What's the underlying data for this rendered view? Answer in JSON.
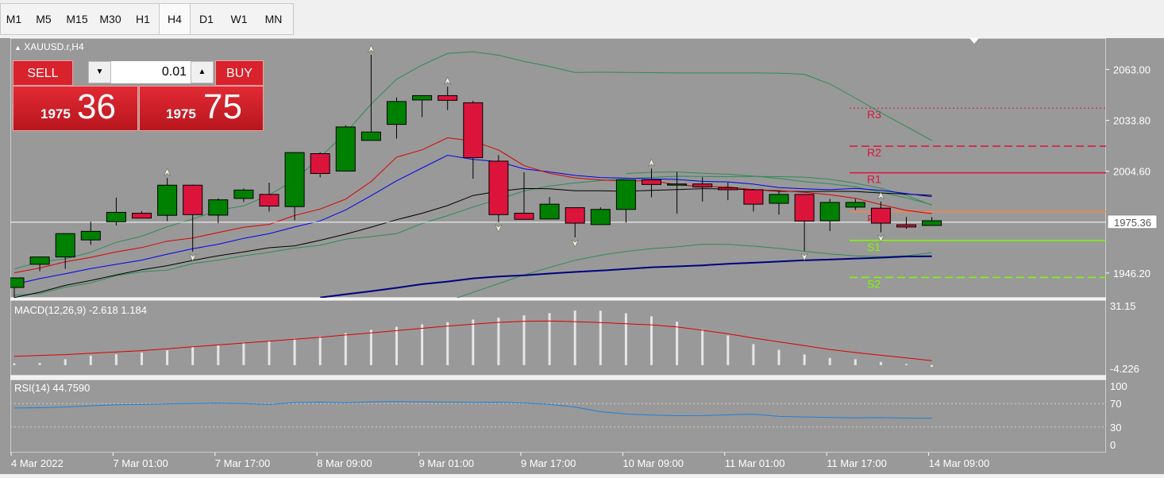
{
  "timeframes": [
    "M1",
    "M5",
    "M15",
    "M30",
    "H1",
    "H4",
    "D1",
    "W1",
    "MN"
  ],
  "active_timeframe": "H4",
  "symbol_label": "XAUUSD.r,H4",
  "trade": {
    "sell_label": "SELL",
    "buy_label": "BUY",
    "lot": "0.01",
    "sell_small": "1975",
    "sell_big": "36",
    "buy_small": "1975",
    "buy_big": "75"
  },
  "price_axis": [
    "2063.00",
    "2033.80",
    "2004.60",
    "1975.36",
    "1946.20"
  ],
  "current_price": "1975.36",
  "pivots": [
    "R3",
    "R2",
    "R1",
    "PP",
    "S1",
    "S2"
  ],
  "macd": {
    "label": "MACD(12,26,9) -2.618 1.184",
    "axis_top": "31.15",
    "axis_bottom": "-4.226"
  },
  "rsi": {
    "label": "RSI(14) 44.7590",
    "axis": [
      "100",
      "70",
      "30",
      "0"
    ]
  },
  "time_axis": [
    "4 Mar 2022",
    "7 Mar 01:00",
    "7 Mar 17:00",
    "8 Mar 09:00",
    "9 Mar 01:00",
    "9 Mar 17:00",
    "10 Mar 09:00",
    "11 Mar 01:00",
    "11 Mar 17:00",
    "14 Mar 09:00"
  ],
  "colors": {
    "background": "#999999",
    "bull": "#008000",
    "bear": "#dc143c",
    "macd_signal": "#dc0000",
    "rsi": "#1e7fd8",
    "ma_blue": "#0000ee",
    "ma_red": "#dc0000",
    "ma_black": "#000000",
    "ma_navy": "#000080",
    "bands": "#2e8b57"
  },
  "chart_data": {
    "type": "candlestick",
    "symbol": "XAUUSD.r",
    "timeframe": "H4",
    "ylim": [
      1932,
      2081
    ],
    "candles": [
      {
        "o": 1937.9,
        "h": 1943.4,
        "l": 1929.6,
        "c": 1943.4
      },
      {
        "o": 1951.2,
        "h": 1955.6,
        "l": 1947.2,
        "c": 1955.4
      },
      {
        "o": 1955.4,
        "h": 1969.0,
        "l": 1948.6,
        "c": 1968.8
      },
      {
        "o": 1965.2,
        "h": 1975.6,
        "l": 1962.4,
        "c": 1970.1
      },
      {
        "o": 1975.6,
        "h": 1989.5,
        "l": 1973.5,
        "c": 1981.0
      },
      {
        "o": 1980.5,
        "h": 1981.7,
        "l": 1977.7,
        "c": 1977.7
      },
      {
        "o": 1979.3,
        "h": 2000.7,
        "l": 1976.0,
        "c": 1996.6
      },
      {
        "o": 1996.6,
        "h": 1996.9,
        "l": 1958.5,
        "c": 1979.7
      },
      {
        "o": 1979.4,
        "h": 1989.0,
        "l": 1974.7,
        "c": 1988.2
      },
      {
        "o": 1989.0,
        "h": 1994.7,
        "l": 1986.9,
        "c": 1993.8
      },
      {
        "o": 1991.3,
        "h": 1998.0,
        "l": 1981.5,
        "c": 1984.6
      },
      {
        "o": 1984.3,
        "h": 2014.7,
        "l": 1976.4,
        "c": 2015.3
      },
      {
        "o": 2014.7,
        "h": 2015.5,
        "l": 2001.1,
        "c": 2003.3
      },
      {
        "o": 2004.7,
        "h": 2031.0,
        "l": 2004.7,
        "c": 2030.0
      },
      {
        "o": 2022.3,
        "h": 2071.4,
        "l": 2022.3,
        "c": 2027.1
      },
      {
        "o": 2031.5,
        "h": 2047.0,
        "l": 2023.3,
        "c": 2044.6
      },
      {
        "o": 2045.5,
        "h": 2046.4,
        "l": 2035.7,
        "c": 2048.0
      },
      {
        "o": 2048.0,
        "h": 2053.1,
        "l": 2039.7,
        "c": 2045.3
      },
      {
        "o": 2043.9,
        "h": 2045.0,
        "l": 2000.3,
        "c": 2012.4
      },
      {
        "o": 2010.4,
        "h": 2013.8,
        "l": 1975.3,
        "c": 1979.7
      },
      {
        "o": 1980.5,
        "h": 2004.1,
        "l": 1977.0,
        "c": 1977.0
      },
      {
        "o": 1977.2,
        "h": 1989.8,
        "l": 1977.2,
        "c": 1985.7
      },
      {
        "o": 1983.7,
        "h": 1983.7,
        "l": 1966.6,
        "c": 1974.8
      },
      {
        "o": 1974.0,
        "h": 1983.9,
        "l": 1974.0,
        "c": 1982.7
      },
      {
        "o": 1982.7,
        "h": 1999.6,
        "l": 1975.1,
        "c": 1999.6
      },
      {
        "o": 1999.6,
        "h": 2006.1,
        "l": 1989.7,
        "c": 1997.0
      },
      {
        "o": 1997.3,
        "h": 2004.1,
        "l": 1980.3,
        "c": 1997.3
      },
      {
        "o": 1997.3,
        "h": 2001.2,
        "l": 1987.2,
        "c": 1995.6
      },
      {
        "o": 1995.1,
        "h": 1998.1,
        "l": 1988.0,
        "c": 1994.0
      },
      {
        "o": 1994.0,
        "h": 1994.4,
        "l": 1981.5,
        "c": 1985.7
      },
      {
        "o": 1986.2,
        "h": 1993.2,
        "l": 1979.6,
        "c": 1991.3
      },
      {
        "o": 1991.3,
        "h": 1991.3,
        "l": 1958.8,
        "c": 1976.0
      },
      {
        "o": 1976.2,
        "h": 1988.7,
        "l": 1970.3,
        "c": 1986.7
      },
      {
        "o": 1984.0,
        "h": 1988.7,
        "l": 1982.3,
        "c": 1986.7
      },
      {
        "o": 1983.4,
        "h": 1987.2,
        "l": 1969.5,
        "c": 1974.8
      },
      {
        "o": 1973.9,
        "h": 1978.3,
        "l": 1971.5,
        "c": 1972.6
      },
      {
        "o": 1973.5,
        "h": 1978.3,
        "l": 1973.5,
        "c": 1976.2
      }
    ],
    "ma_red": [
      1946.3,
      1949.1,
      1952.6,
      1955.2,
      1958.3,
      1960.8,
      1964.5,
      1966.3,
      1969.4,
      1972.4,
      1974.1,
      1979.2,
      1982.9,
      1988.6,
      1998.7,
      2012.7,
      2016.9,
      2023.8,
      2021.9,
      2016.8,
      2007.8,
      2003.4,
      2000.8,
      1999.6,
      1999.0,
      1999.2,
      1996.8,
      1995.8,
      1995.6,
      1994.0,
      1993.5,
      1992.5,
      1991.1,
      1989.1,
      1985.5,
      1982.1,
      1980.3
    ],
    "ma_blue": [
      1939.7,
      1943.0,
      1945.8,
      1948.7,
      1951.2,
      1953.6,
      1957.0,
      1960.1,
      1962.7,
      1966.1,
      1968.8,
      1972.6,
      1976.1,
      1982.4,
      1990.6,
      1999.1,
      2006.5,
      2013.8,
      2011.4,
      2010.1,
      2006.0,
      2004.2,
      2002.2,
      2001.0,
      2000.6,
      2000.2,
      1999.9,
      1998.8,
      1998.5,
      1997.2,
      1995.2,
      1994.5,
      1994.0,
      1994.8,
      1993.6,
      1991.8,
      1990.0
    ],
    "ma_black": [
      1932.1,
      1935.2,
      1939.1,
      1941.9,
      1945.1,
      1948.1,
      1950.4,
      1953.4,
      1956.1,
      1958.3,
      1960.7,
      1961.8,
      1965.0,
      1968.5,
      1972.5,
      1976.8,
      1980.5,
      1984.9,
      1990.7,
      1993.1,
      1994.7,
      1994.5,
      1993.4,
      1993.4,
      1993.1,
      1993.6,
      1994.1,
      1994.6,
      1994.4,
      1994.1,
      1993.1,
      1992.9,
      1993.1,
      1993.0,
      1992.1,
      1991.5,
      1990.8
    ],
    "ma_navy": [
      null,
      null,
      null,
      null,
      null,
      null,
      null,
      null,
      null,
      null,
      null,
      null,
      1932.1,
      1934.0,
      1935.8,
      1937.7,
      1939.8,
      1941.3,
      1943.1,
      1944.2,
      1944.9,
      1945.9,
      1946.8,
      1947.6,
      1948.5,
      1949.5,
      1950.0,
      1950.6,
      1951.5,
      1952.1,
      1952.8,
      1953.5,
      1953.9,
      1954.5,
      1955.0,
      1955.7,
      1955.8
    ],
    "bb_upper": [
      1948.5,
      1952.6,
      1954.3,
      1958.1,
      1963.8,
      1967.3,
      1972.8,
      1977.2,
      1982.2,
      1984.7,
      1991.0,
      1999.6,
      2012.6,
      2026.6,
      2043.2,
      2057.4,
      2065.5,
      2072.2,
      2073.1,
      2071.2,
      2067.6,
      2064.7,
      2061.3,
      2061.4,
      2061.3,
      2061.2,
      2061.0,
      2061.0,
      2061.0,
      2061.0,
      2060.9,
      2060.2,
      2054.7,
      2046.6,
      2038.2,
      2030.3,
      2022.2
    ],
    "bb_lower": [
      1933.4,
      1934.4,
      1938.1,
      1940.5,
      1944.7,
      1946.9,
      1947.9,
      1951.6,
      1953.6,
      1956.1,
      1958.1,
      1960.5,
      1962.1,
      1965.6,
      1967.1,
      1968.8,
      1974.6,
      1979.1,
      1984.1,
      1988.5,
      1993.3,
      1996.1,
      1997.9,
      1999.2,
      2000.3,
      2001.1,
      2001.7,
      2001.6,
      2001.5,
      2001.6,
      2001.5,
      2001.2,
      2000.0,
      1997.7,
      1994.9,
      1990.8,
      1985.1
    ],
    "bb_mid2_upper": [
      null,
      null,
      null,
      null,
      null,
      null,
      null,
      null,
      null,
      null,
      null,
      null,
      null,
      null,
      null,
      null,
      null,
      null,
      null,
      null,
      null,
      null,
      null,
      null,
      2003.3,
      2004.0,
      2004.2,
      2003.4,
      2002.9,
      2001.8,
      2000.5,
      1998.6,
      1997.4,
      1995.7,
      1992.5,
      1989.3,
      1985.4
    ],
    "bb_mid2_lower": [
      null,
      null,
      null,
      null,
      null,
      null,
      null,
      null,
      null,
      null,
      null,
      null,
      null,
      null,
      null,
      null,
      null,
      1930.0,
      1935.1,
      1940.1,
      1945.1,
      1949.4,
      1953.5,
      1956.4,
      1958.6,
      1960.2,
      1961.2,
      1962.7,
      1962.6,
      1961.6,
      1960.4,
      1958.7,
      1957.2,
      1956.0,
      1955.6,
      1956.1,
      1957.9
    ],
    "pivot_levels": {
      "R3": 2040.8,
      "R2": 2019.0,
      "R1": 2003.7,
      "PP": 1981.4,
      "S1": 1964.9,
      "S2": 1943.7
    },
    "macd_hist": [
      0.9,
      1.1,
      3.1,
      5.0,
      5.7,
      6.6,
      7.7,
      9.8,
      10.7,
      11.9,
      12.8,
      13.9,
      15.1,
      16.8,
      18.5,
      20.1,
      21.4,
      22.5,
      23.9,
      24.9,
      26.1,
      27.3,
      28.6,
      28.5,
      27.2,
      25.6,
      22.8,
      18.8,
      15.5,
      11.0,
      8.0,
      5.6,
      3.8,
      3.1,
      1.7,
      0.6,
      -0.9
    ],
    "macd_signal": [
      4.6,
      5.1,
      5.5,
      6.2,
      6.9,
      7.6,
      8.6,
      9.6,
      10.6,
      11.6,
      12.6,
      13.6,
      14.6,
      15.8,
      16.9,
      18.1,
      19.3,
      20.5,
      21.5,
      22.4,
      23.0,
      23.1,
      22.8,
      22.3,
      21.7,
      21.1,
      20.0,
      18.3,
      16.4,
      14.2,
      12.2,
      10.2,
      8.2,
      6.6,
      5.2,
      3.8,
      2.3
    ],
    "macd_ylim": [
      -4.226,
      31.15
    ],
    "rsi_values": [
      62.3,
      62.8,
      64.0,
      66.1,
      67.8,
      68.2,
      69.5,
      70.1,
      70.5,
      69.8,
      68.4,
      71.6,
      72.3,
      71.2,
      72.9,
      73.2,
      72.8,
      72.5,
      72.0,
      72.2,
      71.0,
      68.7,
      64.0,
      56.1,
      52.1,
      50.3,
      49.3,
      49.5,
      50.7,
      51.9,
      48.1,
      47.2,
      46.3,
      45.6,
      46.1,
      45.1,
      44.8
    ],
    "rsi_ylim": [
      0,
      100
    ]
  }
}
